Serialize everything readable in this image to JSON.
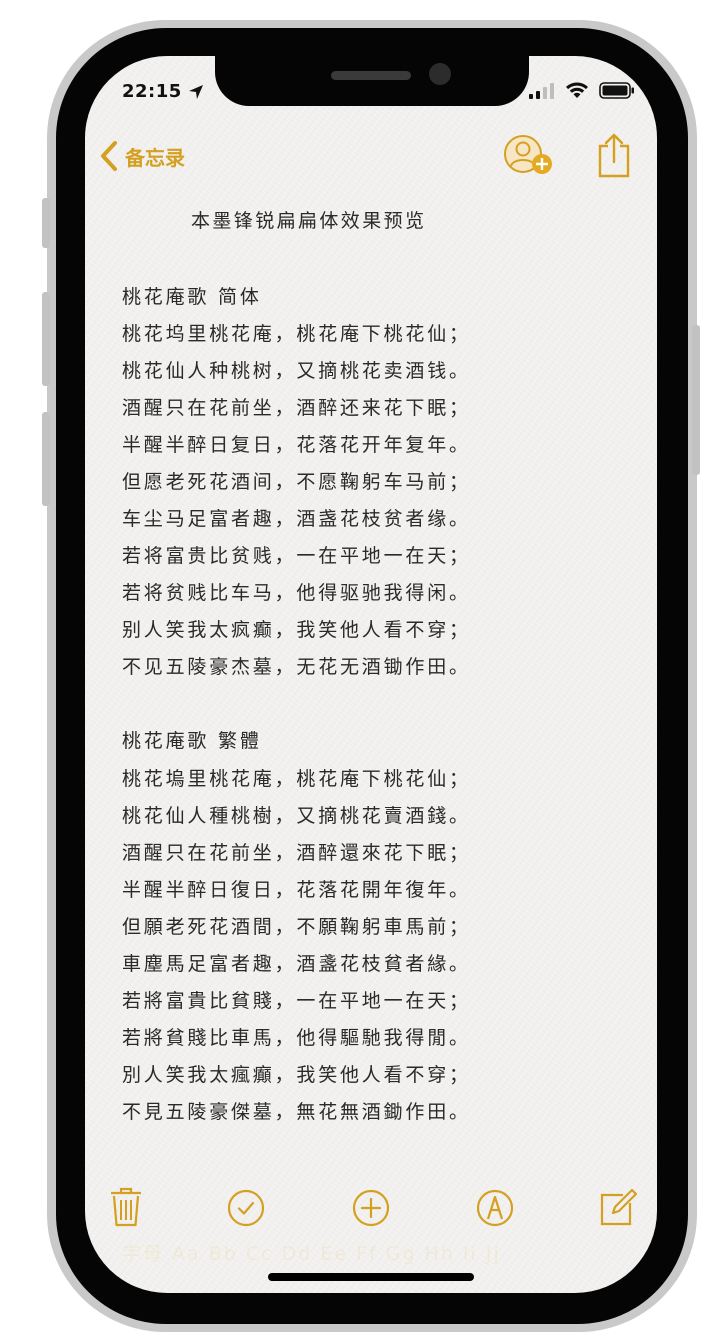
{
  "status_bar": {
    "time": "22:15"
  },
  "nav": {
    "back_label": "备忘录"
  },
  "note": {
    "title": "本墨锋锐扁扁体效果预览",
    "sections": [
      {
        "heading": "桃花庵歌  简体",
        "lines": [
          "桃花坞里桃花庵，桃花庵下桃花仙；",
          "桃花仙人种桃树，又摘桃花卖酒钱。",
          "酒醒只在花前坐，酒醉还来花下眠；",
          "半醒半醉日复日，花落花开年复年。",
          "但愿老死花酒间，不愿鞠躬车马前；",
          "车尘马足富者趣，酒盏花枝贫者缘。",
          "若将富贵比贫贱，一在平地一在天；",
          "若将贫贱比车马，他得驱驰我得闲。",
          "别人笑我太疯癫，我笑他人看不穿；",
          "不见五陵豪杰墓，无花无酒锄作田。"
        ]
      },
      {
        "heading": "桃花庵歌  繁體",
        "lines": [
          "桃花塢里桃花庵，桃花庵下桃花仙；",
          "桃花仙人種桃樹，又摘桃花賣酒錢。",
          "酒醒只在花前坐，酒醉還來花下眠；",
          "半醒半醉日復日，花落花開年復年。",
          "但願老死花酒間，不願鞠躬車馬前；",
          "車塵馬足富者趣，酒盞花枝貧者緣。",
          "若將富貴比貧賤，一在平地一在天；",
          "若將貧賤比車馬，他得驅馳我得閒。",
          "別人笑我太瘋癲，我笑他人看不穿；",
          "不見五陵豪傑墓，無花無酒鋤作田。"
        ]
      }
    ],
    "faded_lines": [
      "字母 Aa Bb Cc Dd Ee Ff Gg Hh Ii Jj"
    ]
  },
  "colors": {
    "accent": "#d4a021",
    "text": "#2a2a2a",
    "paper": "#f4f3f1"
  },
  "icons": {
    "back": "chevron-left-icon",
    "collaborate": "add-person-icon",
    "share": "share-icon",
    "toolbar": [
      "trash-icon",
      "checklist-icon",
      "add-icon",
      "markup-icon",
      "compose-icon"
    ]
  }
}
